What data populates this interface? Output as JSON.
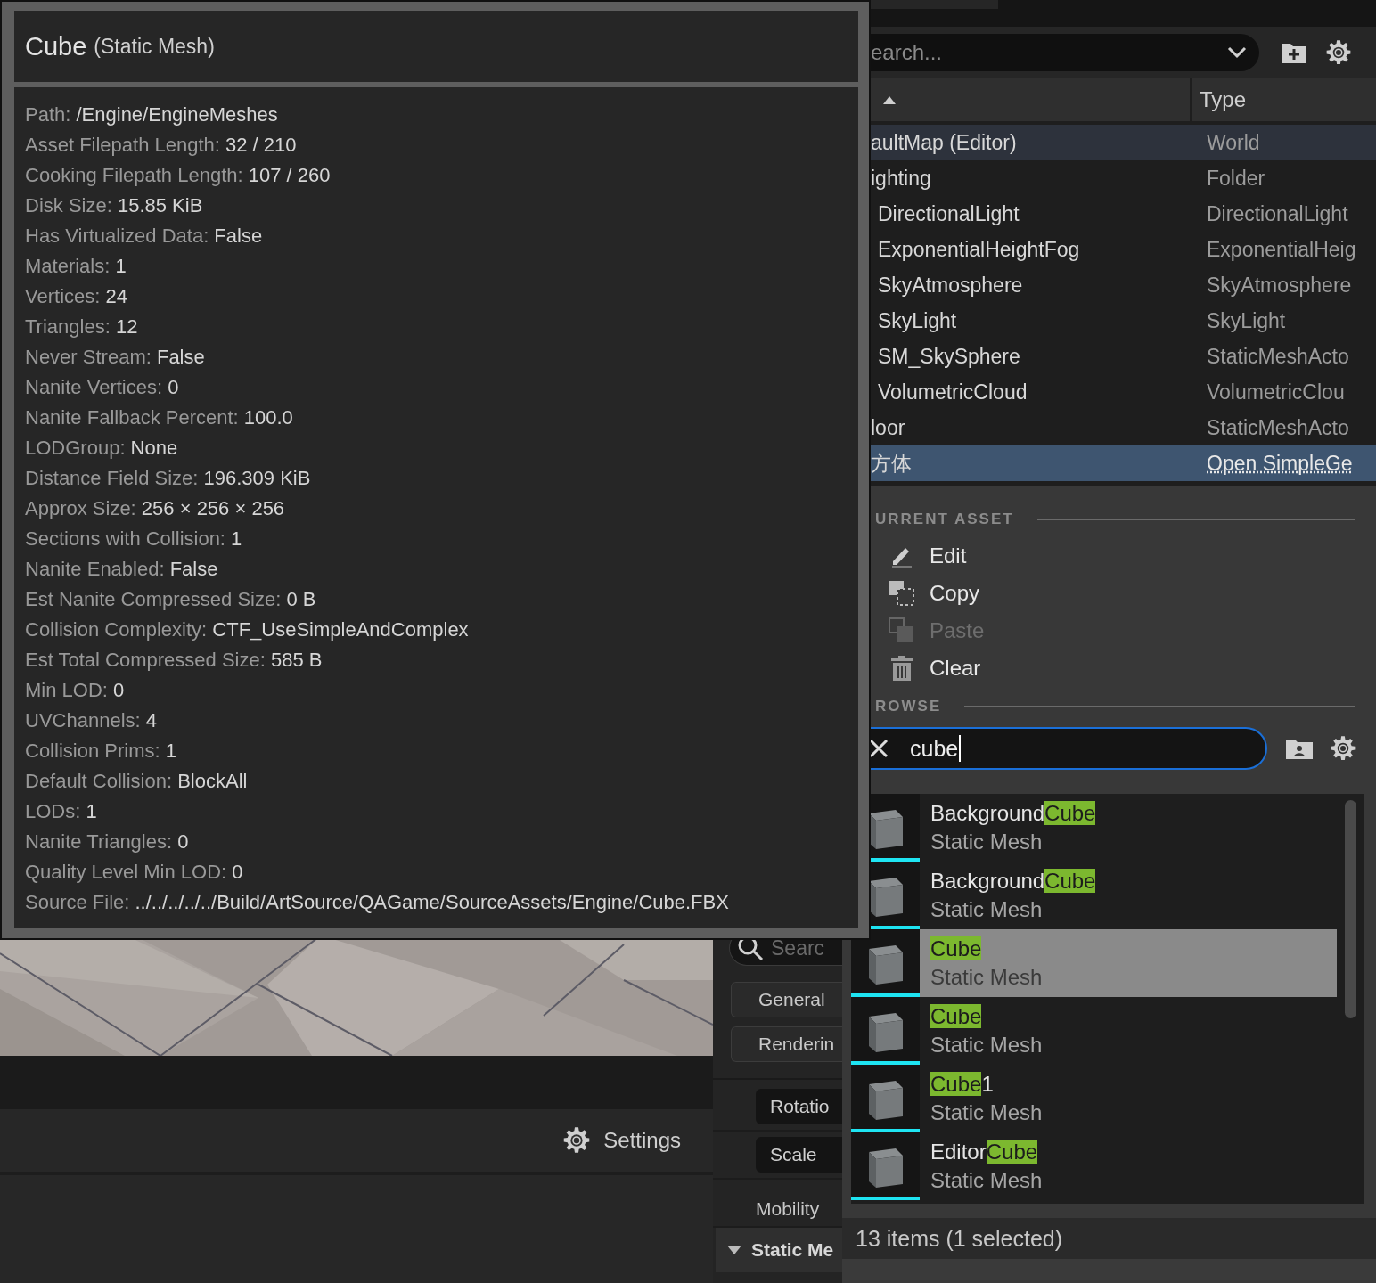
{
  "tooltip": {
    "title": "Cube",
    "subtitle": "(Static Mesh)",
    "properties": [
      {
        "label": "Path:",
        "value": "/Engine/EngineMeshes"
      },
      {
        "label": "Asset Filepath Length:",
        "value": "32 / 210"
      },
      {
        "label": "Cooking Filepath Length:",
        "value": "107 / 260"
      },
      {
        "label": "Disk Size:",
        "value": "15.85 KiB"
      },
      {
        "label": "Has Virtualized Data:",
        "value": "False"
      },
      {
        "label": "Materials:",
        "value": "1"
      },
      {
        "label": "Vertices:",
        "value": "24"
      },
      {
        "label": "Triangles:",
        "value": "12"
      },
      {
        "label": "Never Stream:",
        "value": "False"
      },
      {
        "label": "Nanite Vertices:",
        "value": "0"
      },
      {
        "label": "Nanite Fallback Percent:",
        "value": "100.0"
      },
      {
        "label": "LODGroup:",
        "value": "None"
      },
      {
        "label": "Distance Field Size:",
        "value": "196.309 KiB"
      },
      {
        "label": "Approx Size:",
        "value": "256 × 256 × 256"
      },
      {
        "label": "Sections with Collision:",
        "value": "1"
      },
      {
        "label": "Nanite Enabled:",
        "value": "False"
      },
      {
        "label": "Est Nanite Compressed Size:",
        "value": "0 B"
      },
      {
        "label": "Collision Complexity:",
        "value": "CTF_UseSimpleAndComplex"
      },
      {
        "label": "Est Total Compressed Size:",
        "value": "585 B"
      },
      {
        "label": "Min LOD:",
        "value": "0"
      },
      {
        "label": "UVChannels:",
        "value": "4"
      },
      {
        "label": "Collision Prims:",
        "value": "1"
      },
      {
        "label": "Default Collision:",
        "value": "BlockAll"
      },
      {
        "label": "LODs:",
        "value": "1"
      },
      {
        "label": "Nanite Triangles:",
        "value": "0"
      },
      {
        "label": "Quality Level Min LOD:",
        "value": "0"
      },
      {
        "label": "Source File:",
        "value": "../../../../../Build/ArtSource/QAGame/SourceAssets/Engine/Cube.FBX"
      }
    ]
  },
  "outliner": {
    "search": {
      "placeholder": "earch..."
    },
    "type_column": "Type",
    "rows": [
      {
        "name": "aultMap (Editor)",
        "type": "World",
        "type_link": false,
        "current": true,
        "selected": false
      },
      {
        "name": "ighting",
        "type": "Folder",
        "type_link": false,
        "current": false,
        "selected": false,
        "children": [
          {
            "name": "DirectionalLight",
            "type": "DirectionalLight",
            "type_link": false,
            "current": false,
            "selected": false
          },
          {
            "name": "ExponentialHeightFog",
            "type": "ExponentialHeig",
            "type_link": false,
            "current": false,
            "selected": false
          },
          {
            "name": "SkyAtmosphere",
            "type": "SkyAtmosphere",
            "type_link": false,
            "current": false,
            "selected": false
          },
          {
            "name": "SkyLight",
            "type": "SkyLight",
            "type_link": false,
            "current": false,
            "selected": false
          },
          {
            "name": "SM_SkySphere",
            "type": "StaticMeshActo",
            "type_link": false,
            "current": false,
            "selected": false
          },
          {
            "name": "VolumetricCloud",
            "type": "VolumetricClou",
            "type_link": false,
            "current": false,
            "selected": false
          }
        ]
      },
      {
        "name": "loor",
        "type": "StaticMeshActo",
        "type_link": false,
        "current": false,
        "selected": false
      },
      {
        "name": "方体",
        "type": "Open SimpleGe",
        "type_link": true,
        "current": false,
        "selected": true
      }
    ]
  },
  "details": {
    "search": {
      "placeholder": "Searc"
    },
    "filters": [
      "General",
      "Renderin"
    ],
    "rows": [
      {
        "kind": "button",
        "label": "Rotatio"
      },
      {
        "kind": "button",
        "label": "Scale"
      },
      {
        "kind": "label",
        "label": "Mobility"
      }
    ],
    "section": {
      "label": "Static Me",
      "expanded": true
    }
  },
  "settings_bar": {
    "label": "Settings"
  },
  "menu": {
    "current_heading": "URRENT ASSET",
    "actions": [
      {
        "label": "Edit",
        "disabled": false
      },
      {
        "label": "Copy",
        "disabled": false
      },
      {
        "label": "Paste",
        "disabled": true
      },
      {
        "label": "Clear",
        "disabled": false
      }
    ],
    "browse_heading": "ROWSE",
    "search": {
      "value": "cube"
    },
    "assets": [
      {
        "prefix": "Background",
        "match": "Cube",
        "type": "Static Mesh",
        "selected": false
      },
      {
        "prefix": "Background",
        "match": "Cube",
        "type": "Static Mesh",
        "selected": false
      },
      {
        "match": "Cube",
        "type": "Static Mesh",
        "selected": true
      },
      {
        "match": "Cube",
        "type": "Static Mesh",
        "selected": false
      },
      {
        "match": "Cube",
        "suffix": "1",
        "type": "Static Mesh",
        "selected": false
      },
      {
        "prefix": "Editor",
        "match": "Cube",
        "type": "Static Mesh",
        "selected": false
      }
    ],
    "status": "13 items (1 selected)"
  }
}
